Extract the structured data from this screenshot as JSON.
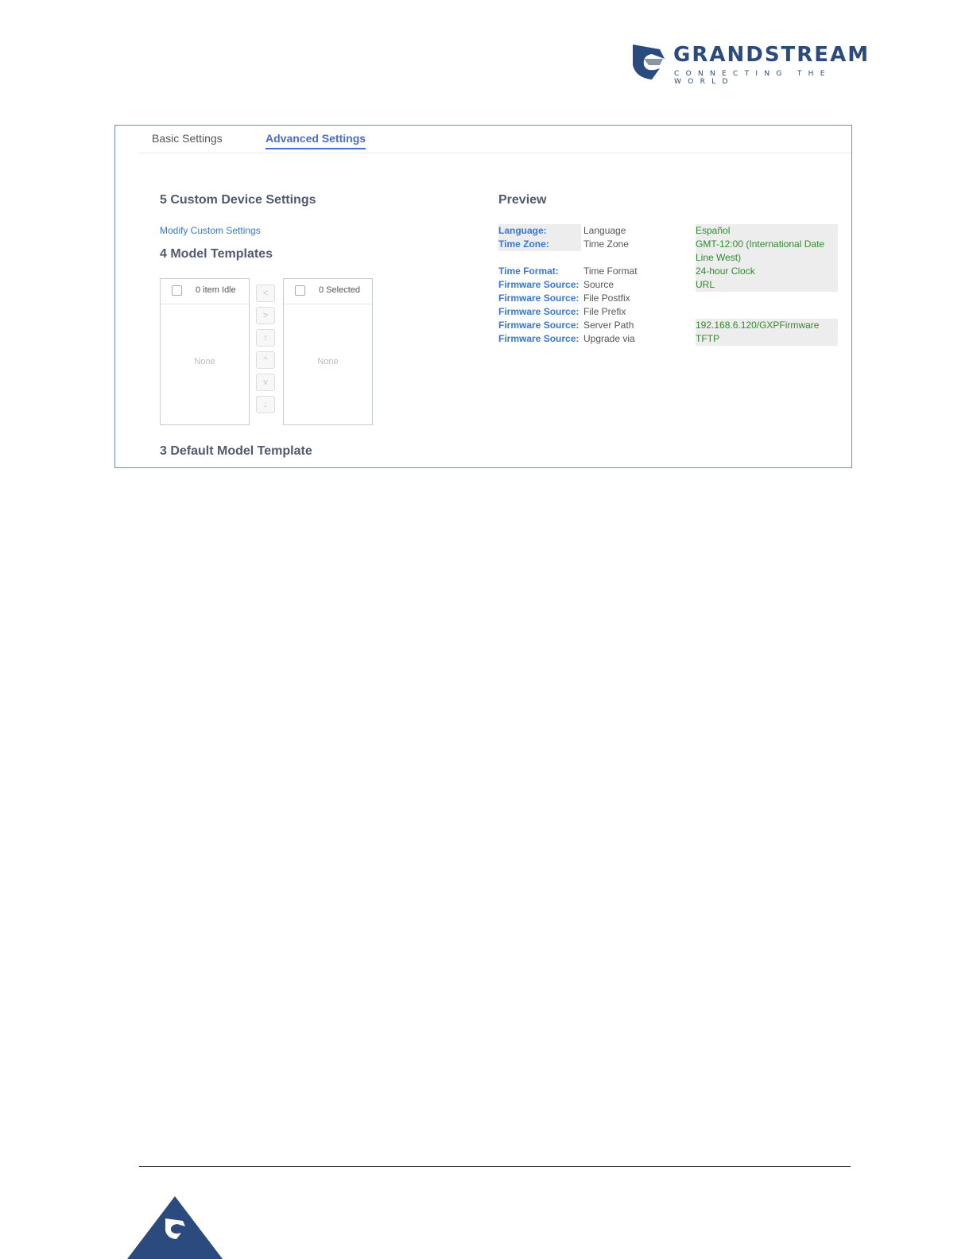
{
  "brand": {
    "name": "GRANDSTREAM",
    "tagline": "CONNECTING THE WORLD",
    "primary_color": "#2b4b7e"
  },
  "tabs": [
    {
      "label": "Basic Settings",
      "active": false
    },
    {
      "label": "Advanced Settings",
      "active": true
    }
  ],
  "custom_device": {
    "title": "5 Custom Device Settings",
    "link_label": "Modify Custom Settings"
  },
  "model_templates": {
    "title": "4 Model Templates",
    "left_list": {
      "header": "0 item Idle",
      "empty": "None"
    },
    "right_list": {
      "header": "0 Selected",
      "empty": "None"
    },
    "move_buttons": [
      "<",
      ">",
      "↑",
      "^",
      "v",
      "↓"
    ]
  },
  "default_model": {
    "title": "3 Default Model Template"
  },
  "preview": {
    "title": "Preview",
    "rows": [
      {
        "key": "Language:",
        "name": "Language",
        "value": "Español"
      },
      {
        "key": "Time Zone:",
        "name": "Time Zone",
        "value": "GMT-12:00 (International Date Line West)"
      },
      {
        "key": "Time Format:",
        "name": "Time Format",
        "value": "24-hour Clock"
      },
      {
        "key": "Firmware Source:",
        "name": "Source",
        "value": "URL"
      },
      {
        "key": "Firmware Source:",
        "name": "File Postfix",
        "value": ""
      },
      {
        "key": "Firmware Source:",
        "name": "File Prefix",
        "value": ""
      },
      {
        "key": "Firmware Source:",
        "name": "Server Path",
        "value": "192.168.6.120/GXPFirmware"
      },
      {
        "key": "Firmware Source:",
        "name": "Upgrade via",
        "value": "TFTP"
      }
    ]
  }
}
